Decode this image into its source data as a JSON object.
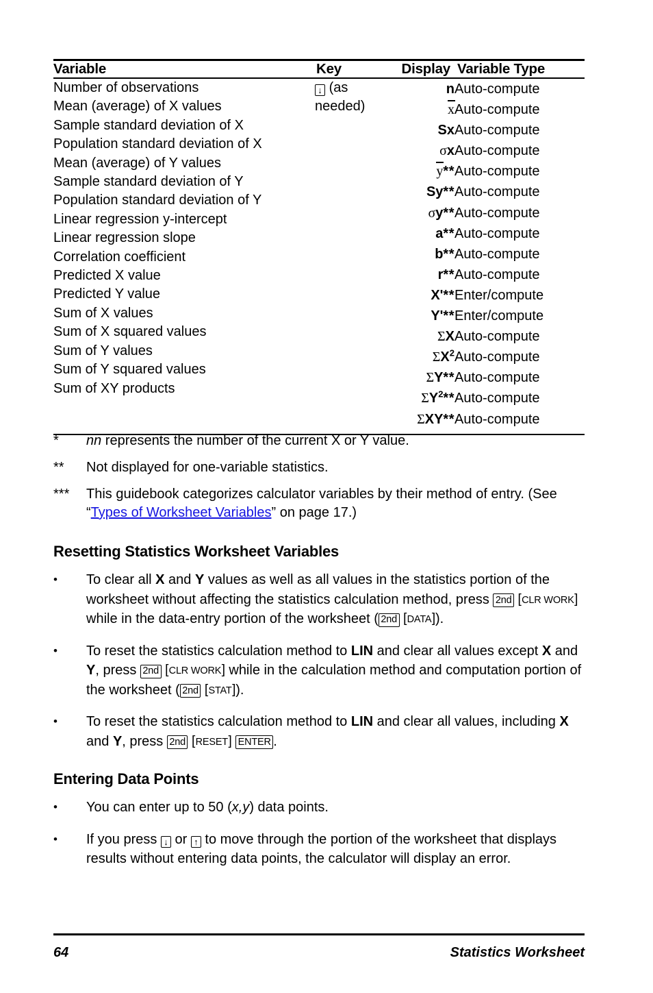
{
  "table": {
    "headers": {
      "variable": "Variable",
      "key": "Key",
      "display": "Display",
      "type": "Variable Type"
    },
    "key_cell": {
      "icon": "down-arrow-key-icon",
      "line1_suffix": "(as",
      "line2": "needed)"
    },
    "rows": [
      {
        "variable": "Number of observations",
        "display": "n",
        "type": "Auto-compute"
      },
      {
        "variable": "Mean (average) of X values",
        "display": "x̄",
        "type": "Auto-compute"
      },
      {
        "variable": "Sample standard deviation of X",
        "display": "Sx",
        "type": "Auto-compute"
      },
      {
        "variable": "Population standard deviation of X",
        "display": "σx",
        "type": "Auto-compute"
      },
      {
        "variable": "Mean (average) of Y values",
        "display": "ȳ**",
        "type": "Auto-compute"
      },
      {
        "variable": "Sample standard deviation of Y",
        "display": "Sy**",
        "type": "Auto-compute"
      },
      {
        "variable": "Population standard deviation of Y",
        "display": "σy**",
        "type": "Auto-compute"
      },
      {
        "variable": "Linear regression y-intercept",
        "display": "a**",
        "type": "Auto-compute"
      },
      {
        "variable": "Linear regression slope",
        "display": "b**",
        "type": "Auto-compute"
      },
      {
        "variable": "Correlation coefficient",
        "display": "r**",
        "type": "Auto-compute"
      },
      {
        "variable": "Predicted X value",
        "display": "X'**",
        "type": "Enter/compute"
      },
      {
        "variable": "Predicted Y value",
        "display": "Y'**",
        "type": "Enter/compute"
      },
      {
        "variable": "Sum of X values",
        "display": "ΣX",
        "type": "Auto-compute"
      },
      {
        "variable": "Sum of X squared values",
        "display": "ΣX²",
        "type": "Auto-compute"
      },
      {
        "variable": "Sum of Y values",
        "display": "ΣY**",
        "type": "Auto-compute"
      },
      {
        "variable": "Sum of Y squared values",
        "display": "ΣY²**",
        "type": "Auto-compute"
      },
      {
        "variable": "Sum of XY products",
        "display": "ΣXY**",
        "type": "Auto-compute"
      }
    ]
  },
  "footnotes": [
    {
      "mark": "*",
      "pre": "",
      "italic": "nn",
      "post": " represents the number of the current X or Y value."
    },
    {
      "mark": "**",
      "text": "Not displayed for one-variable statistics."
    },
    {
      "mark": "***",
      "pre": "This guidebook categorizes calculator variables by their method of entry. (See “",
      "link": "Types of Worksheet Variables",
      "post": "” on page 17.)"
    }
  ],
  "reset_section": {
    "heading": "Resetting Statistics Worksheet Variables",
    "bullet_char": "•",
    "bullets": [
      {
        "p1": "To clear all ",
        "b1": "X",
        "p2": " and ",
        "b2": "Y",
        "p3": " values as well as all values in the statistics portion of the worksheet without affecting the statistics calculation method, press ",
        "key1": "2nd",
        "key2": "CLR WORK",
        "p4": " while in the data-entry portion of the worksheet (",
        "key3": "2nd",
        "key4": "DATA",
        "p5": ")."
      },
      {
        "p1": "To reset the statistics calculation method to ",
        "b1": "LIN",
        "p2": " and clear all values except ",
        "b2": "X",
        "p3": " and ",
        "b3": "Y",
        "p4": ", press ",
        "key1": "2nd",
        "key2": "CLR WORK",
        "p5": " while in the calculation method and computation portion of the worksheet (",
        "key3": "2nd",
        "key4": "STAT",
        "p6": ")."
      },
      {
        "p1": "To reset the statistics calculation method to ",
        "b1": "LIN",
        "p2": " and clear all values, including ",
        "b2": "X",
        "p3": " and ",
        "b3": "Y",
        "p4": ", press ",
        "key1": "2nd",
        "key2": "RESET",
        "key3": "ENTER",
        "p5": "."
      }
    ]
  },
  "entry_section": {
    "heading": "Entering Data Points",
    "bullet_char": "•",
    "bullet1": {
      "p1": "You can enter up to 50 (",
      "i1": "x,y",
      "p2": ") data points."
    },
    "bullet2": {
      "p1": "If you press ",
      "key_down": "down-arrow-key-icon",
      "p2": " or ",
      "key_up": "up-arrow-key-icon",
      "p3": " to move through the portion of the worksheet that displays results without entering data points, the calculator will display an error."
    }
  },
  "footer": {
    "page_number": "64",
    "title": "Statistics Worksheet"
  },
  "colors": {
    "text": "#000000",
    "link": "#1414E0",
    "rule": "#000000",
    "background": "#FFFFFF"
  }
}
